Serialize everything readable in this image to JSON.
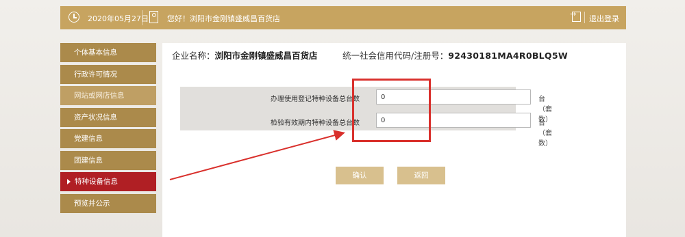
{
  "header": {
    "date": "2020年05月27日",
    "greeting": "您好！浏阳市金刚镇盛威昌百货店",
    "logout": "退出登录"
  },
  "sidebar": {
    "items": [
      {
        "label": "个体基本信息"
      },
      {
        "label": "行政许可情况"
      },
      {
        "label": "网站或网店信息"
      },
      {
        "label": "资产状况信息"
      },
      {
        "label": "党建信息"
      },
      {
        "label": "团建信息"
      },
      {
        "label": "特种设备信息"
      },
      {
        "label": "预览并公示"
      }
    ]
  },
  "main": {
    "company_label": "企业名称：",
    "company_name": "浏阳市金刚镇盛威昌百货店",
    "credit_label": "统一社会信用代码/注册号：",
    "credit_code": "92430181MA4R0BLQ5W",
    "form": {
      "fields": [
        {
          "label": "办理使用登记特种设备总台数",
          "value": "0",
          "unit": "台（套数）"
        },
        {
          "label": "检验有效期内特种设备总台数",
          "value": "0",
          "unit": "台（套数）"
        }
      ]
    },
    "buttons": {
      "confirm": "确认",
      "back": "返回"
    }
  },
  "annotations": {
    "highlight_color": "#d9302c"
  }
}
